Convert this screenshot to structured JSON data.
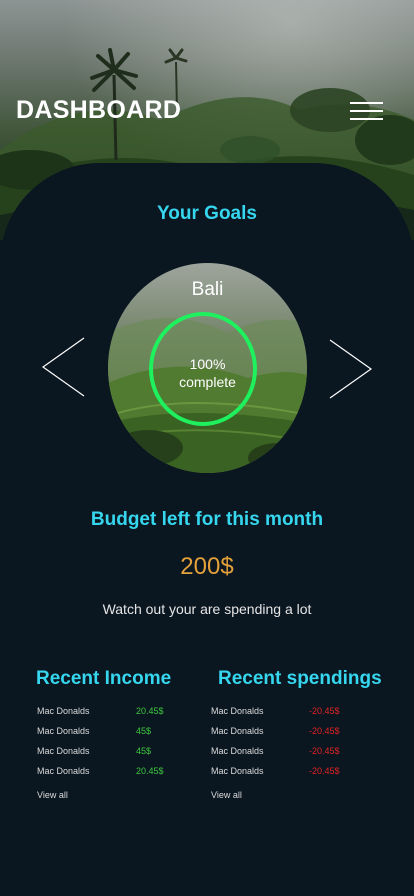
{
  "header": {
    "title": "DASHBOARD",
    "menu_icon": "hamburger-icon"
  },
  "goals": {
    "section_title": "Your Goals",
    "current": {
      "name": "Bali",
      "progress_text": "100%",
      "progress_suffix": "complete",
      "progress": 1.0
    },
    "prev_icon": "chevron-left-icon",
    "next_icon": "chevron-right-icon",
    "ring_color": "#1ef05e"
  },
  "budget": {
    "title": "Budget left for this month",
    "amount": "200$",
    "warning": "Watch out your are spending a lot"
  },
  "income": {
    "title": "Recent Income",
    "items": [
      {
        "name": "Mac Donalds",
        "amount": "20.45$"
      },
      {
        "name": "Mac Donalds",
        "amount": "45$"
      },
      {
        "name": "Mac Donalds",
        "amount": "45$"
      },
      {
        "name": "Mac Donalds",
        "amount": "20.45$"
      }
    ],
    "view_all": "View all",
    "amount_color": "#3ec93e"
  },
  "spendings": {
    "title": "Recent spendings",
    "items": [
      {
        "name": "Mac Donalds",
        "amount": "-20.45$"
      },
      {
        "name": "Mac Donalds",
        "amount": "-20.45$"
      },
      {
        "name": "Mac Donalds",
        "amount": "-20.45$"
      },
      {
        "name": "Mac Donalds",
        "amount": "-20.45$"
      }
    ],
    "view_all": "View all",
    "amount_color": "#e02424"
  },
  "colors": {
    "accent": "#35d6ee",
    "background": "#0a1620",
    "budget_amount": "#e3a13a"
  }
}
